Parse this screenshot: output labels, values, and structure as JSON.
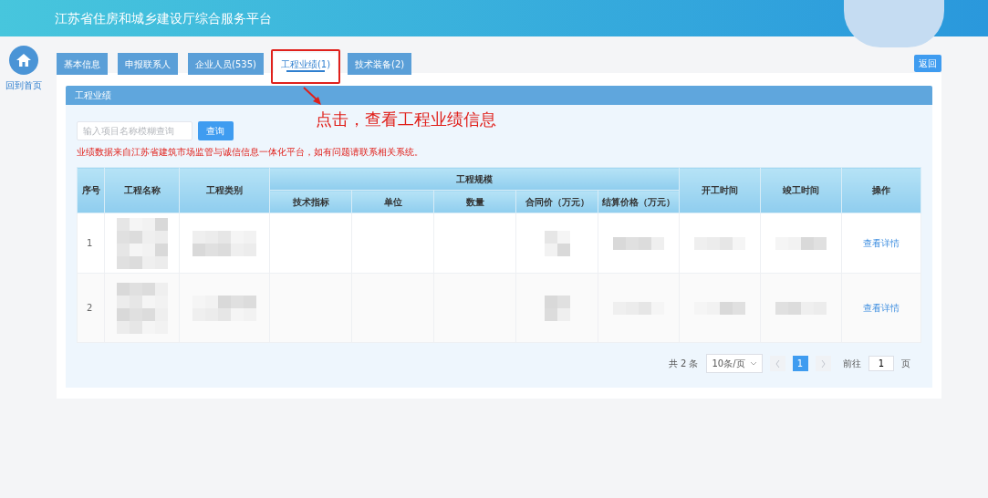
{
  "header": {
    "title": "江苏省住房和城乡建设厅综合服务平台"
  },
  "sidebar": {
    "home_label": "回到首页"
  },
  "tabs": [
    {
      "label": "基本信息",
      "selected": false
    },
    {
      "label": "申报联系人",
      "selected": false
    },
    {
      "label": "企业人员(535)",
      "selected": false
    },
    {
      "label": "工程业绩(1)",
      "selected": true
    },
    {
      "label": "技术装备(2)",
      "selected": false
    }
  ],
  "return_button": "返回",
  "panel": {
    "title": "工程业绩"
  },
  "annotation": {
    "text": "点击，查看工程业绩信息"
  },
  "search": {
    "placeholder": "输入项目名称模糊查询",
    "button": "查询"
  },
  "notice": "业绩数据来自江苏省建筑市场监管与诚信信息一体化平台，如有问题请联系相关系统。",
  "table": {
    "group_header": "工程规模",
    "columns": [
      {
        "label": "序号",
        "kind": "single"
      },
      {
        "label": "工程名称",
        "kind": "single"
      },
      {
        "label": "工程类别",
        "kind": "single"
      },
      {
        "label": "技术指标",
        "kind": "grouped"
      },
      {
        "label": "单位",
        "kind": "grouped"
      },
      {
        "label": "数量",
        "kind": "grouped"
      },
      {
        "label": "合同价（万元）",
        "kind": "grouped"
      },
      {
        "label": "结算价格（万元）",
        "kind": "grouped"
      },
      {
        "label": "开工时间",
        "kind": "single"
      },
      {
        "label": "竣工时间",
        "kind": "single"
      },
      {
        "label": "操作",
        "kind": "single"
      }
    ],
    "rows": [
      {
        "index": "1",
        "action": "查看详情"
      },
      {
        "index": "2",
        "action": "查看详情"
      }
    ]
  },
  "pagination": {
    "total": "共 2 条",
    "page_size": "10条/页",
    "pages": [
      {
        "label": "1",
        "selected": true
      }
    ],
    "goto_label": "前往",
    "goto_value": "1",
    "page_unit": "页"
  }
}
